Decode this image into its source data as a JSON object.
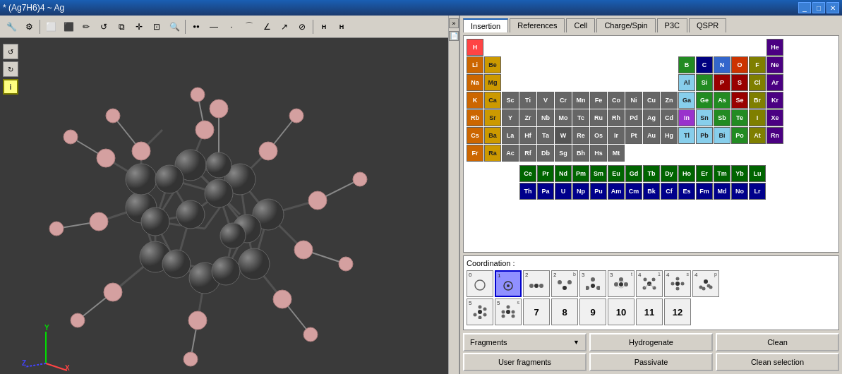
{
  "titlebar": {
    "title": "* (Ag7H6)4 ~ Ag",
    "controls": [
      "minimize",
      "maximize",
      "close"
    ],
    "minimize_label": "_",
    "maximize_label": "□",
    "close_label": "✕"
  },
  "toolbar": {
    "buttons": [
      {
        "name": "settings",
        "icon": "⚙",
        "label": "Settings"
      },
      {
        "name": "bond1",
        "icon": "◻",
        "label": "Bond 1"
      },
      {
        "name": "bond2",
        "icon": "◻",
        "label": "Bond 2"
      },
      {
        "name": "draw",
        "icon": "✏",
        "label": "Draw"
      },
      {
        "name": "undo",
        "icon": "↺",
        "label": "Undo"
      },
      {
        "name": "copy",
        "icon": "⧉",
        "label": "Copy"
      },
      {
        "name": "move",
        "icon": "✛",
        "label": "Move"
      },
      {
        "name": "zoom-box",
        "icon": "⊡",
        "label": "Zoom Box"
      },
      {
        "name": "zoom",
        "icon": "🔍",
        "label": "Zoom"
      },
      {
        "name": "atom",
        "icon": "●",
        "label": "Atom"
      },
      {
        "name": "bond-tool",
        "icon": "⚊",
        "label": "Bond Tool"
      },
      {
        "name": "dot",
        "icon": "·",
        "label": "Dot"
      },
      {
        "name": "curve",
        "icon": "⌒",
        "label": "Curve"
      },
      {
        "name": "angle",
        "icon": "∠",
        "label": "Angle"
      },
      {
        "name": "arrow",
        "icon": "↗",
        "label": "Arrow"
      },
      {
        "name": "edit",
        "icon": "⊘",
        "label": "Edit"
      },
      {
        "name": "h-bond",
        "icon": "H",
        "label": "H Bond"
      },
      {
        "name": "hh-bond",
        "icon": "H",
        "label": "HH Bond"
      }
    ]
  },
  "tabs": [
    {
      "id": "insertion",
      "label": "Insertion",
      "active": true
    },
    {
      "id": "references",
      "label": "References",
      "active": false
    },
    {
      "id": "cell",
      "label": "Cell",
      "active": false
    },
    {
      "id": "charge-spin",
      "label": "Charge/Spin",
      "active": false
    },
    {
      "id": "p3c",
      "label": "P3C",
      "active": false
    },
    {
      "id": "qspr",
      "label": "QSPR",
      "active": false
    }
  ],
  "periodic_table": {
    "rows": [
      [
        {
          "symbol": "H",
          "color": "h"
        },
        {
          "symbol": "",
          "color": "empty"
        },
        {
          "symbol": "",
          "color": "empty"
        },
        {
          "symbol": "",
          "color": "empty"
        },
        {
          "symbol": "",
          "color": "empty"
        },
        {
          "symbol": "",
          "color": "empty"
        },
        {
          "symbol": "",
          "color": "empty"
        },
        {
          "symbol": "",
          "color": "empty"
        },
        {
          "symbol": "",
          "color": "empty"
        },
        {
          "symbol": "",
          "color": "empty"
        },
        {
          "symbol": "",
          "color": "empty"
        },
        {
          "symbol": "",
          "color": "empty"
        },
        {
          "symbol": "",
          "color": "empty"
        },
        {
          "symbol": "",
          "color": "empty"
        },
        {
          "symbol": "",
          "color": "empty"
        },
        {
          "symbol": "",
          "color": "empty"
        },
        {
          "symbol": "",
          "color": "empty"
        },
        {
          "symbol": "He",
          "color": "noble"
        }
      ],
      [
        {
          "symbol": "Li",
          "color": "alkali"
        },
        {
          "symbol": "Be",
          "color": "alkaline"
        },
        {
          "symbol": "",
          "color": "empty"
        },
        {
          "symbol": "",
          "color": "empty"
        },
        {
          "symbol": "",
          "color": "empty"
        },
        {
          "symbol": "",
          "color": "empty"
        },
        {
          "symbol": "",
          "color": "empty"
        },
        {
          "symbol": "",
          "color": "empty"
        },
        {
          "symbol": "",
          "color": "empty"
        },
        {
          "symbol": "",
          "color": "empty"
        },
        {
          "symbol": "",
          "color": "empty"
        },
        {
          "symbol": "",
          "color": "empty"
        },
        {
          "symbol": "B",
          "color": "metalloid"
        },
        {
          "symbol": "C",
          "color": "selected"
        },
        {
          "symbol": "N",
          "color": "n"
        },
        {
          "symbol": "O",
          "color": "o"
        },
        {
          "symbol": "F",
          "color": "halogen"
        },
        {
          "symbol": "Ne",
          "color": "noble"
        }
      ],
      [
        {
          "symbol": "Na",
          "color": "alkali"
        },
        {
          "symbol": "Mg",
          "color": "alkaline"
        },
        {
          "symbol": "",
          "color": "empty"
        },
        {
          "symbol": "",
          "color": "empty"
        },
        {
          "symbol": "",
          "color": "empty"
        },
        {
          "symbol": "",
          "color": "empty"
        },
        {
          "symbol": "",
          "color": "empty"
        },
        {
          "symbol": "",
          "color": "empty"
        },
        {
          "symbol": "",
          "color": "empty"
        },
        {
          "symbol": "",
          "color": "empty"
        },
        {
          "symbol": "",
          "color": "empty"
        },
        {
          "symbol": "",
          "color": "empty"
        },
        {
          "symbol": "Al",
          "color": "post-transition"
        },
        {
          "symbol": "Si",
          "color": "metalloid"
        },
        {
          "symbol": "P",
          "color": "nonmetal"
        },
        {
          "symbol": "S",
          "color": "nonmetal"
        },
        {
          "symbol": "Cl",
          "color": "halogen"
        },
        {
          "symbol": "Ar",
          "color": "noble"
        }
      ],
      [
        {
          "symbol": "K",
          "color": "alkali"
        },
        {
          "symbol": "Ca",
          "color": "alkaline"
        },
        {
          "symbol": "Sc",
          "color": "transition"
        },
        {
          "symbol": "Ti",
          "color": "transition"
        },
        {
          "symbol": "V",
          "color": "transition"
        },
        {
          "symbol": "Cr",
          "color": "transition"
        },
        {
          "symbol": "Mn",
          "color": "transition"
        },
        {
          "symbol": "Fe",
          "color": "transition"
        },
        {
          "symbol": "Co",
          "color": "transition"
        },
        {
          "symbol": "Ni",
          "color": "transition"
        },
        {
          "symbol": "Cu",
          "color": "transition"
        },
        {
          "symbol": "Zn",
          "color": "transition"
        },
        {
          "symbol": "Ga",
          "color": "post-transition"
        },
        {
          "symbol": "Ge",
          "color": "metalloid"
        },
        {
          "symbol": "As",
          "color": "metalloid"
        },
        {
          "symbol": "Se",
          "color": "nonmetal"
        },
        {
          "symbol": "Br",
          "color": "halogen"
        },
        {
          "symbol": "Kr",
          "color": "noble"
        }
      ],
      [
        {
          "symbol": "Rb",
          "color": "alkali"
        },
        {
          "symbol": "Sr",
          "color": "alkaline"
        },
        {
          "symbol": "Y",
          "color": "transition"
        },
        {
          "symbol": "Zr",
          "color": "transition"
        },
        {
          "symbol": "Nb",
          "color": "transition"
        },
        {
          "symbol": "Mo",
          "color": "transition"
        },
        {
          "symbol": "Tc",
          "color": "transition"
        },
        {
          "symbol": "Ru",
          "color": "transition"
        },
        {
          "symbol": "Rh",
          "color": "transition"
        },
        {
          "symbol": "Pd",
          "color": "transition"
        },
        {
          "symbol": "Ag",
          "color": "transition"
        },
        {
          "symbol": "Cd",
          "color": "transition"
        },
        {
          "symbol": "In",
          "color": "special"
        },
        {
          "symbol": "Sn",
          "color": "post-transition"
        },
        {
          "symbol": "Sb",
          "color": "metalloid"
        },
        {
          "symbol": "Te",
          "color": "metalloid"
        },
        {
          "symbol": "I",
          "color": "halogen"
        },
        {
          "symbol": "Xe",
          "color": "noble"
        }
      ],
      [
        {
          "symbol": "Cs",
          "color": "alkali"
        },
        {
          "symbol": "Ba",
          "color": "alkaline"
        },
        {
          "symbol": "La",
          "color": "transition"
        },
        {
          "symbol": "Hf",
          "color": "transition"
        },
        {
          "symbol": "Ta",
          "color": "transition"
        },
        {
          "symbol": "W",
          "color": "transition"
        },
        {
          "symbol": "Re",
          "color": "transition"
        },
        {
          "symbol": "Os",
          "color": "transition"
        },
        {
          "symbol": "Ir",
          "color": "transition"
        },
        {
          "symbol": "Pt",
          "color": "transition"
        },
        {
          "symbol": "Au",
          "color": "transition"
        },
        {
          "symbol": "Hg",
          "color": "transition"
        },
        {
          "symbol": "Tl",
          "color": "post-transition"
        },
        {
          "symbol": "Pb",
          "color": "post-transition"
        },
        {
          "symbol": "Bi",
          "color": "post-transition"
        },
        {
          "symbol": "Po",
          "color": "metalloid"
        },
        {
          "symbol": "At",
          "color": "halogen"
        },
        {
          "symbol": "Rn",
          "color": "noble"
        }
      ],
      [
        {
          "symbol": "Fr",
          "color": "alkali"
        },
        {
          "symbol": "Ra",
          "color": "alkaline"
        },
        {
          "symbol": "Ac",
          "color": "transition"
        },
        {
          "symbol": "Rf",
          "color": "transition"
        },
        {
          "symbol": "Db",
          "color": "transition"
        },
        {
          "symbol": "Sg",
          "color": "transition"
        },
        {
          "symbol": "Bh",
          "color": "transition"
        },
        {
          "symbol": "Hs",
          "color": "transition"
        },
        {
          "symbol": "Mt",
          "color": "transition"
        },
        {
          "symbol": "",
          "color": "empty"
        },
        {
          "symbol": "",
          "color": "empty"
        },
        {
          "symbol": "",
          "color": "empty"
        },
        {
          "symbol": "",
          "color": "empty"
        },
        {
          "symbol": "",
          "color": "empty"
        },
        {
          "symbol": "",
          "color": "empty"
        },
        {
          "symbol": "",
          "color": "empty"
        },
        {
          "symbol": "",
          "color": "empty"
        },
        {
          "symbol": "",
          "color": "empty"
        }
      ]
    ],
    "lanthanides": [
      {
        "symbol": "Ce",
        "color": "lanthanide"
      },
      {
        "symbol": "Pr",
        "color": "lanthanide"
      },
      {
        "symbol": "Nd",
        "color": "lanthanide"
      },
      {
        "symbol": "Pm",
        "color": "lanthanide"
      },
      {
        "symbol": "Sm",
        "color": "lanthanide"
      },
      {
        "symbol": "Eu",
        "color": "lanthanide"
      },
      {
        "symbol": "Gd",
        "color": "lanthanide"
      },
      {
        "symbol": "Tb",
        "color": "lanthanide"
      },
      {
        "symbol": "Dy",
        "color": "lanthanide"
      },
      {
        "symbol": "Ho",
        "color": "lanthanide"
      },
      {
        "symbol": "Er",
        "color": "lanthanide"
      },
      {
        "symbol": "Tm",
        "color": "lanthanide"
      },
      {
        "symbol": "Yb",
        "color": "lanthanide"
      },
      {
        "symbol": "Lu",
        "color": "lanthanide"
      }
    ],
    "actinides": [
      {
        "symbol": "Th",
        "color": "actinide"
      },
      {
        "symbol": "Pa",
        "color": "actinide"
      },
      {
        "symbol": "U",
        "color": "actinide"
      },
      {
        "symbol": "Np",
        "color": "actinide"
      },
      {
        "symbol": "Pu",
        "color": "actinide"
      },
      {
        "symbol": "Am",
        "color": "actinide"
      },
      {
        "symbol": "Cm",
        "color": "actinide"
      },
      {
        "symbol": "Bk",
        "color": "actinide"
      },
      {
        "symbol": "Cf",
        "color": "actinide"
      },
      {
        "symbol": "Es",
        "color": "actinide"
      },
      {
        "symbol": "Fm",
        "color": "actinide"
      },
      {
        "symbol": "Md",
        "color": "actinide"
      },
      {
        "symbol": "No",
        "color": "actinide"
      },
      {
        "symbol": "Lr",
        "color": "actinide"
      }
    ]
  },
  "coordination": {
    "label": "Coordination :",
    "items": [
      {
        "num": "0",
        "sub": "",
        "type": "circle",
        "selected": false
      },
      {
        "num": "1",
        "sub": "",
        "type": "selected-circle",
        "selected": true
      },
      {
        "num": "2",
        "sub": "",
        "type": "linear",
        "selected": false
      },
      {
        "num": "2",
        "sub": "b",
        "type": "bent",
        "selected": false
      },
      {
        "num": "3",
        "sub": "",
        "type": "trigonal",
        "selected": false
      },
      {
        "num": "3",
        "sub": "t",
        "type": "t-shape",
        "selected": false
      },
      {
        "num": "4",
        "sub": "1",
        "type": "tetrahedral",
        "selected": false
      },
      {
        "num": "4",
        "sub": "s",
        "type": "square",
        "selected": false
      },
      {
        "num": "4",
        "sub": "p",
        "type": "pyramid",
        "selected": false
      },
      {
        "num": "5",
        "sub": "",
        "type": "tbp",
        "selected": false
      },
      {
        "num": "5",
        "sub": "s",
        "type": "sq-pyr",
        "selected": false
      },
      {
        "num": "7",
        "sub": "",
        "type": "plain",
        "selected": false
      },
      {
        "num": "8",
        "sub": "",
        "type": "plain",
        "selected": false
      },
      {
        "num": "9",
        "sub": "",
        "type": "plain",
        "selected": false
      },
      {
        "num": "10",
        "sub": "",
        "type": "plain",
        "selected": false
      },
      {
        "num": "11",
        "sub": "",
        "type": "plain",
        "selected": false
      },
      {
        "num": "12",
        "sub": "",
        "type": "plain",
        "selected": false
      }
    ]
  },
  "buttons": {
    "fragments_label": "Fragments",
    "fragments_dropdown": "▼",
    "hydrogenate": "Hydrogenate",
    "clean": "Clean",
    "user_fragments": "User fragments",
    "passivate": "Passivate",
    "clean_selection": "Clean selection"
  },
  "strip": {
    "expand": "»",
    "page": "📄"
  }
}
